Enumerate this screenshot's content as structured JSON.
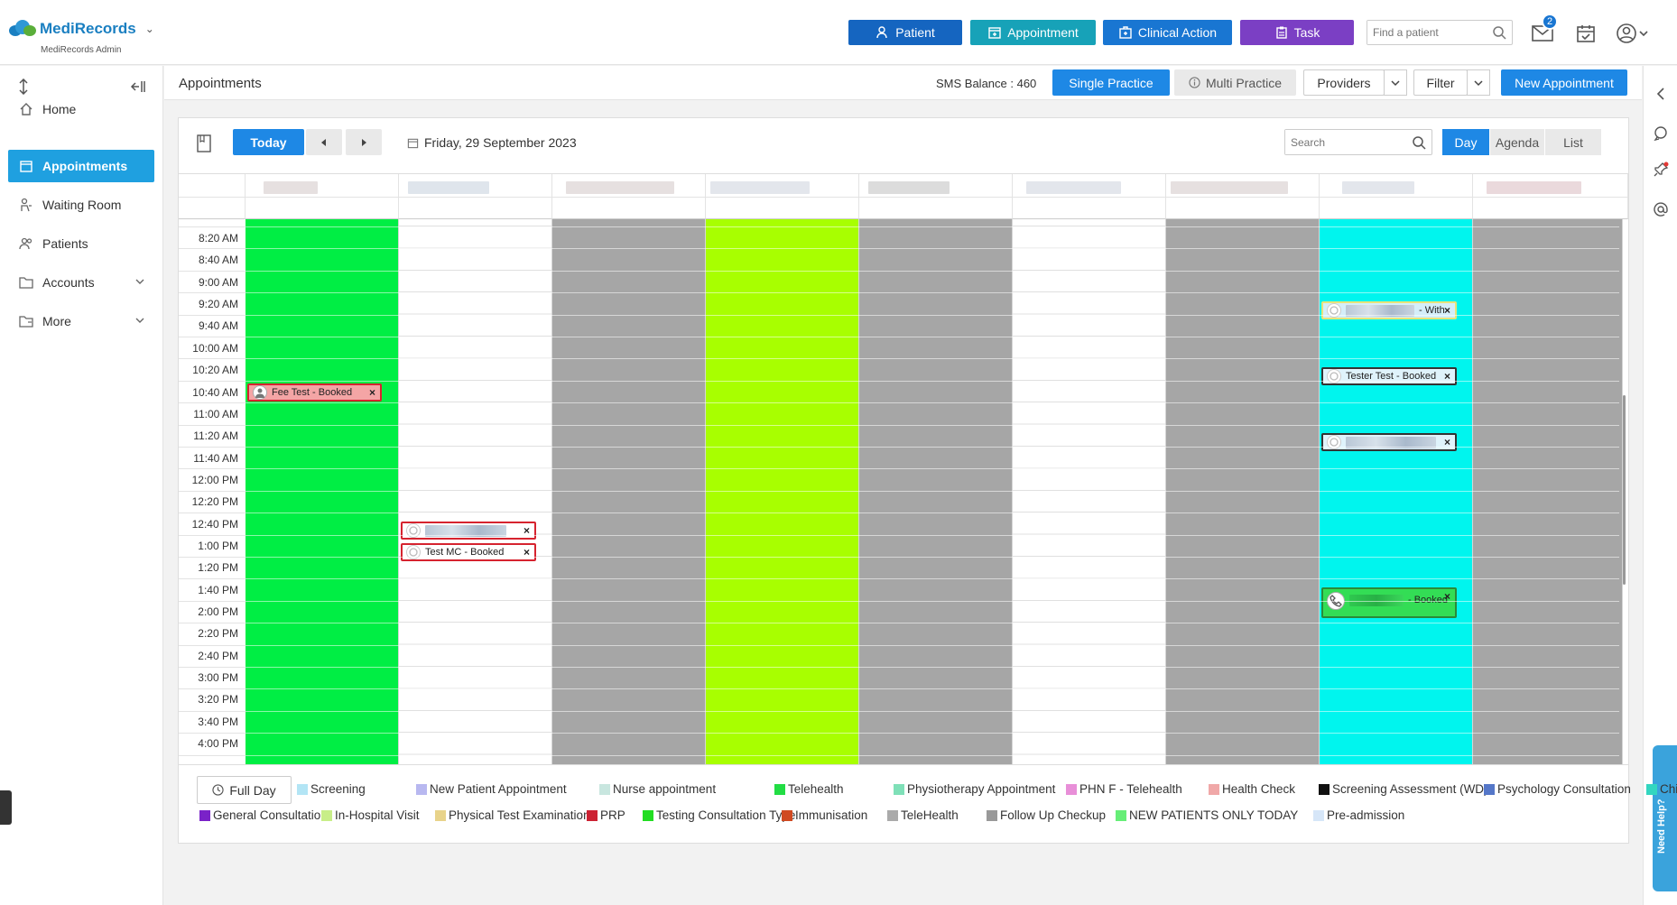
{
  "header": {
    "brand": "MediRecords",
    "sub": "MediRecords Admin",
    "buttons": [
      {
        "label": "Patient",
        "color": "#1565c0"
      },
      {
        "label": "Appointment",
        "color": "#17a2b8"
      },
      {
        "label": "Clinical Action",
        "color": "#1976d2"
      },
      {
        "label": "Task",
        "color": "#7b3fc4"
      }
    ],
    "find_placeholder": "Find a patient",
    "mail_count": "2"
  },
  "sidebar": {
    "items": [
      {
        "label": "Home"
      },
      {
        "label": "Appointments"
      },
      {
        "label": "Waiting Room"
      },
      {
        "label": "Patients"
      },
      {
        "label": "Accounts"
      },
      {
        "label": "More"
      }
    ]
  },
  "content_header": {
    "title": "Appointments",
    "sms": "SMS Balance : 460",
    "single_practice": "Single Practice",
    "multi_practice": "Multi Practice",
    "providers": "Providers",
    "filter": "Filter",
    "new_appointment": "New Appointment"
  },
  "scheduler": {
    "today": "Today",
    "date": "Friday, 29 September 2023",
    "search_placeholder": "Search",
    "views": [
      "Day",
      "Agenda",
      "List"
    ],
    "times": [
      "8:20 AM",
      "8:40 AM",
      "9:00 AM",
      "9:20 AM",
      "9:40 AM",
      "10:00 AM",
      "10:20 AM",
      "10:40 AM",
      "11:00 AM",
      "11:20 AM",
      "11:40 AM",
      "12:00 PM",
      "12:20 PM",
      "12:40 PM",
      "1:00 PM",
      "1:20 PM",
      "1:40 PM",
      "2:00 PM",
      "2:20 PM",
      "2:40 PM",
      "3:00 PM",
      "3:20 PM",
      "3:40 PM",
      "4:00 PM"
    ],
    "column_colors": [
      "#00ee44",
      "#ffffff",
      "#a6a6a6",
      "#a8ff00",
      "#a6a6a6",
      "#ffffff",
      "#a6a6a6",
      "#00f5ee",
      "#a6a6a6"
    ],
    "appointments": {
      "fee": "Fee Test - Booked",
      "mc": "Test MC - Booked",
      "with": "- With",
      "tester": "Tester Test - Booked",
      "booked": "- Booked"
    }
  },
  "legend": {
    "full_day": "Full Day",
    "row1": [
      {
        "label": "Screening",
        "color": "#b3e5f5"
      },
      {
        "label": "New Patient Appointment",
        "color": "#b8b8f0"
      },
      {
        "label": "Nurse appointment",
        "color": "#c8e6df"
      },
      {
        "label": "Telehealth",
        "color": "#22dd44"
      },
      {
        "label": "Physiotherapy Appointment",
        "color": "#7fe0b8"
      },
      {
        "label": "PHN F - Telehealth",
        "color": "#e88fd8"
      },
      {
        "label": "Health Check",
        "color": "#f0a8a8"
      },
      {
        "label": "Screening Assessment (WD)",
        "color": "#111111"
      },
      {
        "label": "Psychology Consultation",
        "color": "#5577c8"
      },
      {
        "label": "Children's",
        "color": "#33d6c0"
      }
    ],
    "row2": [
      {
        "label": "General Consultation",
        "color": "#7a22c8"
      },
      {
        "label": "In-Hospital Visit",
        "color": "#c8ee88"
      },
      {
        "label": "Physical Test Examination",
        "color": "#e8d38a"
      },
      {
        "label": "PRP",
        "color": "#cc2233"
      },
      {
        "label": "Testing Consultation Type",
        "color": "#22dd22"
      },
      {
        "label": "Immunisation",
        "color": "#d04a22"
      },
      {
        "label": "TeleHealth",
        "color": "#aaaaaa"
      },
      {
        "label": "Follow Up Checkup",
        "color": "#999999"
      },
      {
        "label": "NEW PATIENTS ONLY TODAY",
        "color": "#66ee77"
      },
      {
        "label": "Pre-admission",
        "color": "#d6e6f8"
      }
    ]
  },
  "help": "Need Help?"
}
